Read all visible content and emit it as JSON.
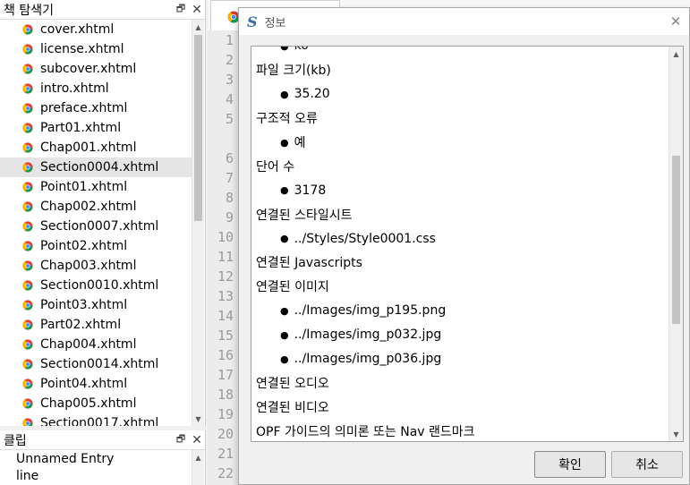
{
  "browser": {
    "title": "책 탐색기",
    "float_icon": "restore-icon",
    "close_icon": "close-icon",
    "files": [
      {
        "name": "cover.xhtml",
        "selected": false
      },
      {
        "name": "license.xhtml",
        "selected": false
      },
      {
        "name": "subcover.xhtml",
        "selected": false
      },
      {
        "name": "intro.xhtml",
        "selected": false
      },
      {
        "name": "preface.xhtml",
        "selected": false
      },
      {
        "name": "Part01.xhtml",
        "selected": false
      },
      {
        "name": "Chap001.xhtml",
        "selected": false
      },
      {
        "name": "Section0004.xhtml",
        "selected": true
      },
      {
        "name": "Point01.xhtml",
        "selected": false
      },
      {
        "name": "Chap002.xhtml",
        "selected": false
      },
      {
        "name": "Section0007.xhtml",
        "selected": false
      },
      {
        "name": "Point02.xhtml",
        "selected": false
      },
      {
        "name": "Chap003.xhtml",
        "selected": false
      },
      {
        "name": "Section0010.xhtml",
        "selected": false
      },
      {
        "name": "Point03.xhtml",
        "selected": false
      },
      {
        "name": "Part02.xhtml",
        "selected": false
      },
      {
        "name": "Chap004.xhtml",
        "selected": false
      },
      {
        "name": "Section0014.xhtml",
        "selected": false
      },
      {
        "name": "Point04.xhtml",
        "selected": false
      },
      {
        "name": "Chap005.xhtml",
        "selected": false
      },
      {
        "name": "Section0017.xhtml",
        "selected": false
      }
    ]
  },
  "clip": {
    "title": "클립",
    "items": [
      "Unnamed Entry",
      "line"
    ]
  },
  "editor": {
    "line_numbers": [
      "1",
      "2",
      "3",
      "4",
      "5",
      "",
      "6",
      "7",
      "8",
      "9",
      "10",
      "11",
      "12",
      "13",
      "14",
      "15",
      "16",
      "17",
      "18",
      "19",
      "20",
      "21",
      "22"
    ]
  },
  "dialog": {
    "logo": "S",
    "title": "정보",
    "close_icon": "close-icon",
    "rows": [
      {
        "type": "bullet",
        "text": "ko"
      },
      {
        "type": "head",
        "text": "파일 크기(kb)"
      },
      {
        "type": "bullet",
        "text": "35.20"
      },
      {
        "type": "head",
        "text": "구조적 오류"
      },
      {
        "type": "bullet",
        "text": "예"
      },
      {
        "type": "head",
        "text": "단어 수"
      },
      {
        "type": "bullet",
        "text": "3178"
      },
      {
        "type": "head",
        "text": "연결된 스타일시트"
      },
      {
        "type": "bullet",
        "text": "../Styles/Style0001.css"
      },
      {
        "type": "head",
        "text": "연결된 Javascripts"
      },
      {
        "type": "head",
        "text": "연결된 이미지"
      },
      {
        "type": "bullet",
        "text": "../Images/img_p195.png"
      },
      {
        "type": "bullet",
        "text": "../Images/img_p032.jpg"
      },
      {
        "type": "bullet",
        "text": "../Images/img_p036.jpg"
      },
      {
        "type": "head",
        "text": "연결된 오디오"
      },
      {
        "type": "head",
        "text": "연결된 비디오"
      },
      {
        "type": "head",
        "text": "OPF 가이드의 의미론 또는 Nav 랜드마크"
      }
    ],
    "ok_label": "확인",
    "cancel_label": "취소"
  },
  "colors": {
    "selected_row": "#e5e5e5",
    "logo_blue": "#3a6ea5",
    "file_icon": "chrome-like-browser-icon"
  }
}
